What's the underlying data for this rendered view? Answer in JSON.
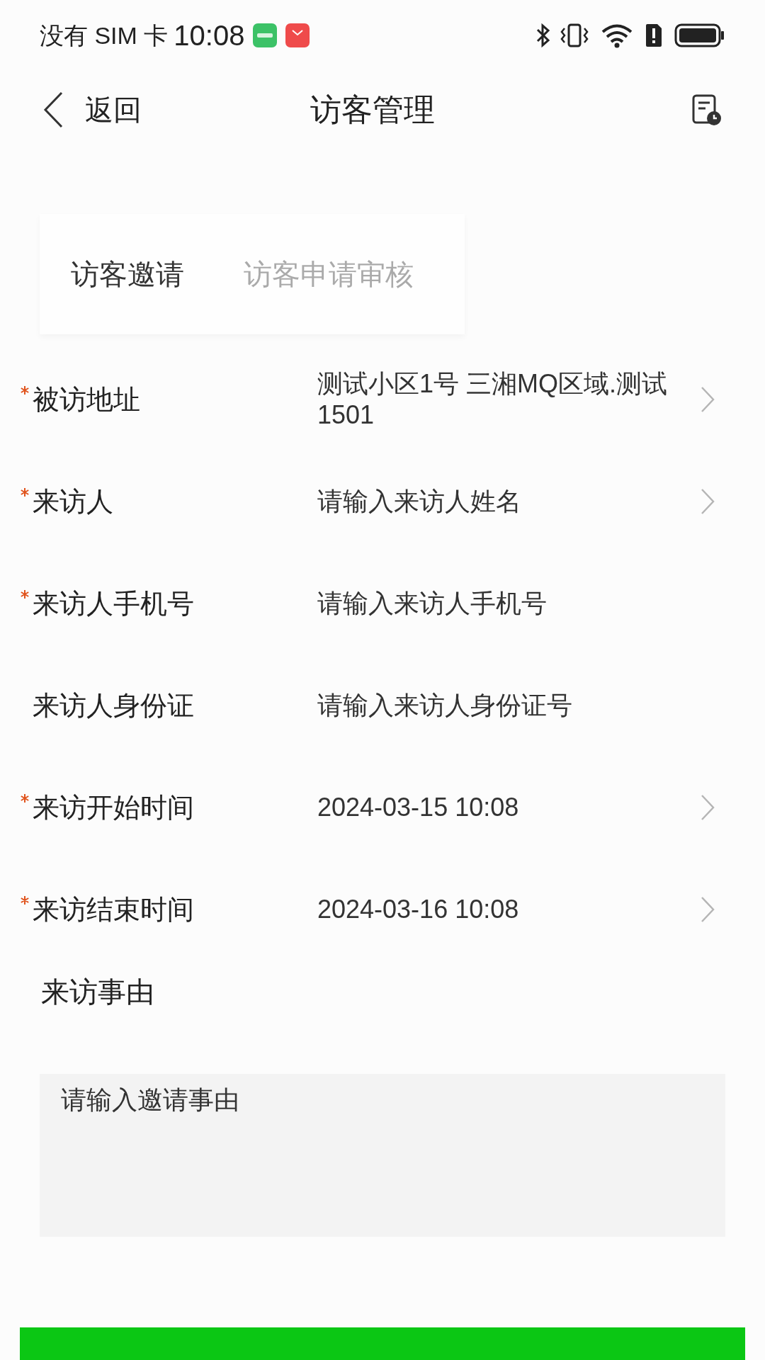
{
  "status_bar": {
    "carrier": "没有 SIM 卡",
    "time": "10:08"
  },
  "header": {
    "back_label": "返回",
    "title": "访客管理"
  },
  "tabs": [
    {
      "label": "访客邀请",
      "selected": true
    },
    {
      "label": "访客申请审核",
      "selected": false
    }
  ],
  "form": {
    "fields": [
      {
        "label": "被访地址",
        "required": true,
        "kind": "select",
        "value": "测试小区1号 三湘MQ区域.测试1501"
      },
      {
        "label": "来访人",
        "required": true,
        "kind": "select",
        "placeholder": "请输入来访人姓名"
      },
      {
        "label": "来访人手机号",
        "required": true,
        "kind": "input",
        "placeholder": "请输入来访人手机号"
      },
      {
        "label": "来访人身份证",
        "required": false,
        "kind": "input",
        "placeholder": "请输入来访人身份证号"
      },
      {
        "label": "来访开始时间",
        "required": true,
        "kind": "select",
        "value": "2024-03-15 10:08"
      },
      {
        "label": "来访结束时间",
        "required": true,
        "kind": "select",
        "value": "2024-03-16 10:08"
      }
    ],
    "reason": {
      "label": "来访事由",
      "placeholder": "请输入邀请事由"
    }
  }
}
